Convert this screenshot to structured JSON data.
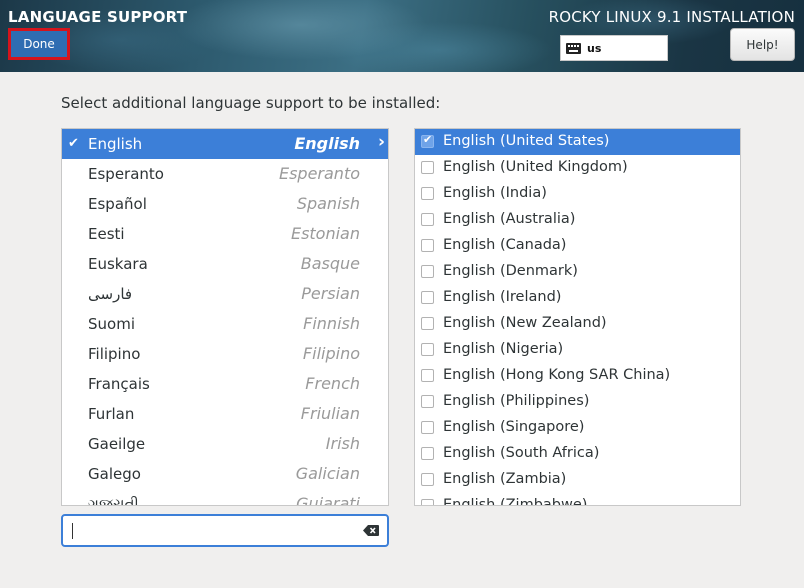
{
  "header": {
    "title": "LANGUAGE SUPPORT",
    "product": "ROCKY LINUX 9.1 INSTALLATION",
    "done_label": "Done",
    "keyboard_layout": "us",
    "help_label": "Help!"
  },
  "prompt": "Select additional language support to be installed:",
  "languages": [
    {
      "native": "English",
      "english": "English",
      "selected": true
    },
    {
      "native": "Esperanto",
      "english": "Esperanto"
    },
    {
      "native": "Español",
      "english": "Spanish"
    },
    {
      "native": "Eesti",
      "english": "Estonian"
    },
    {
      "native": "Euskara",
      "english": "Basque"
    },
    {
      "native": "فارسی",
      "english": "Persian"
    },
    {
      "native": "Suomi",
      "english": "Finnish"
    },
    {
      "native": "Filipino",
      "english": "Filipino"
    },
    {
      "native": "Français",
      "english": "French"
    },
    {
      "native": "Furlan",
      "english": "Friulian"
    },
    {
      "native": "Gaeilge",
      "english": "Irish"
    },
    {
      "native": "Galego",
      "english": "Galician"
    },
    {
      "native": "ગુજરાતી",
      "english": "Gujarati"
    }
  ],
  "locales": [
    {
      "label": "English (United States)",
      "checked": true,
      "selected": true
    },
    {
      "label": "English (United Kingdom)",
      "checked": false
    },
    {
      "label": "English (India)",
      "checked": false
    },
    {
      "label": "English (Australia)",
      "checked": false
    },
    {
      "label": "English (Canada)",
      "checked": false
    },
    {
      "label": "English (Denmark)",
      "checked": false
    },
    {
      "label": "English (Ireland)",
      "checked": false
    },
    {
      "label": "English (New Zealand)",
      "checked": false
    },
    {
      "label": "English (Nigeria)",
      "checked": false
    },
    {
      "label": "English (Hong Kong SAR China)",
      "checked": false
    },
    {
      "label": "English (Philippines)",
      "checked": false
    },
    {
      "label": "English (Singapore)",
      "checked": false
    },
    {
      "label": "English (South Africa)",
      "checked": false
    },
    {
      "label": "English (Zambia)",
      "checked": false
    },
    {
      "label": "English (Zimbabwe)",
      "checked": false
    }
  ],
  "search": {
    "value": ""
  },
  "icons": {
    "keyboard": "keyboard-icon",
    "check": "checkmark-icon",
    "arrow": "chevron-right-icon",
    "clear": "clear-text-icon"
  },
  "colors": {
    "accent": "#3c7fd8",
    "done_button": "#2f6db2",
    "highlight_border": "#d5141c"
  }
}
